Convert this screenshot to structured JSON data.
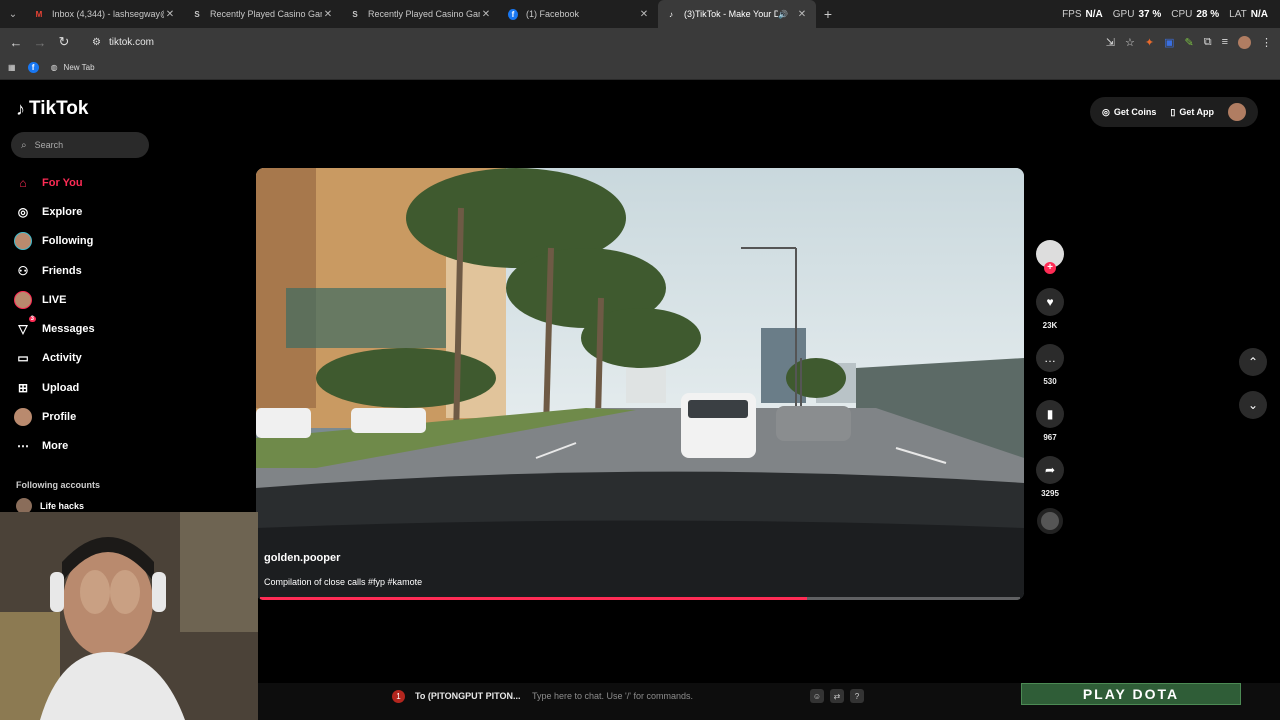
{
  "browser": {
    "tabs": [
      {
        "title": "Inbox (4,344) - lashsegway@gm",
        "icon": "gmail-icon"
      },
      {
        "title": "Recently Played Casino Games",
        "icon": "casino-s-icon"
      },
      {
        "title": "Recently Played Casino Games",
        "icon": "casino-s-icon"
      },
      {
        "title": "(1) Facebook",
        "icon": "facebook-icon"
      },
      {
        "title": "(3)TikTok - Make Your Day",
        "icon": "tiktok-icon",
        "active": true
      }
    ],
    "stats": {
      "fps_label": "FPS",
      "fps": "N/A",
      "gpu_label": "GPU",
      "gpu": "37 %",
      "cpu_label": "CPU",
      "cpu": "28 %",
      "lat_label": "LAT",
      "lat": "N/A"
    },
    "url": "tiktok.com",
    "bookmarks": {
      "newtab": "New Tab"
    }
  },
  "tiktok": {
    "logo": "TikTok",
    "search_placeholder": "Search",
    "nav": [
      {
        "label": "For You",
        "icon": "home-icon"
      },
      {
        "label": "Explore",
        "icon": "compass-icon"
      },
      {
        "label": "Following",
        "icon": "avatar"
      },
      {
        "label": "Friends",
        "icon": "friends-icon"
      },
      {
        "label": "LIVE",
        "icon": "avatar"
      },
      {
        "label": "Messages",
        "icon": "messages-icon",
        "badge": "3"
      },
      {
        "label": "Activity",
        "icon": "activity-icon"
      },
      {
        "label": "Upload",
        "icon": "upload-icon"
      },
      {
        "label": "Profile",
        "icon": "avatar"
      },
      {
        "label": "More",
        "icon": "more-icon"
      }
    ],
    "following_title": "Following accounts",
    "following": [
      {
        "name": "Life hacks"
      }
    ],
    "topright": {
      "coins": "Get Coins",
      "app": "Get App"
    },
    "video": {
      "author": "golden.pooper",
      "caption": "Compilation of close calls #fyp #kamote",
      "progress": 0.72
    },
    "actions": {
      "likes": "23K",
      "comments": "530",
      "saves": "967",
      "shares": "3295"
    }
  },
  "overlay": {
    "chat_count": "1",
    "chat_to": "To (PITONGPUT PITON...",
    "chat_placeholder": "Type here to chat. Use '/' for commands.",
    "banner": "PLAY DOTA"
  },
  "colors": {
    "accent": "#fe2c55",
    "chrome": "#3a3a3a",
    "tabstrip": "#1f1f1f"
  }
}
